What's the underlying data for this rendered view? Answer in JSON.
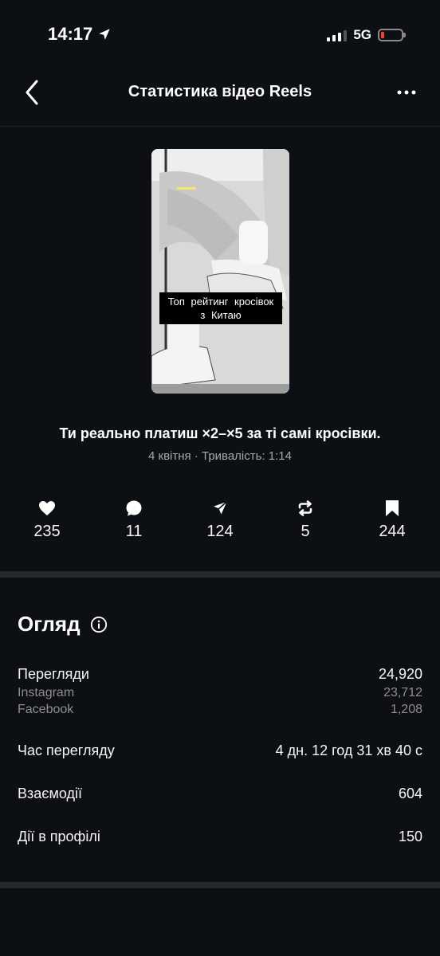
{
  "status_bar": {
    "time": "14:17",
    "network": "5G"
  },
  "header": {
    "title": "Статистика відео Reels"
  },
  "video": {
    "caption_line1": "Топ рейтинг кросівок",
    "caption_line2": "з Китаю",
    "title": "Ти реально платиш ×2–×5 за ті самі кросівки.",
    "meta": "4 квітня · Тривалість: 1:14"
  },
  "stats": {
    "likes": "235",
    "comments": "11",
    "shares": "124",
    "reposts": "5",
    "saves": "244"
  },
  "overview": {
    "title": "Огляд",
    "views_label": "Перегляди",
    "views_value": "24,920",
    "instagram_label": "Instagram",
    "instagram_value": "23,712",
    "facebook_label": "Facebook",
    "facebook_value": "1,208",
    "watch_time_label": "Час перегляду",
    "watch_time_value": "4 дн. 12 год 31 хв 40 с",
    "interactions_label": "Взаємодії",
    "interactions_value": "604",
    "profile_actions_label": "Дії в профілі",
    "profile_actions_value": "150"
  },
  "colors": {
    "background": "#0c1014",
    "text": "#f5f5f5",
    "muted": "#8e8e8e",
    "separator": "#262a2f",
    "battery_low": "#ff3b30"
  }
}
